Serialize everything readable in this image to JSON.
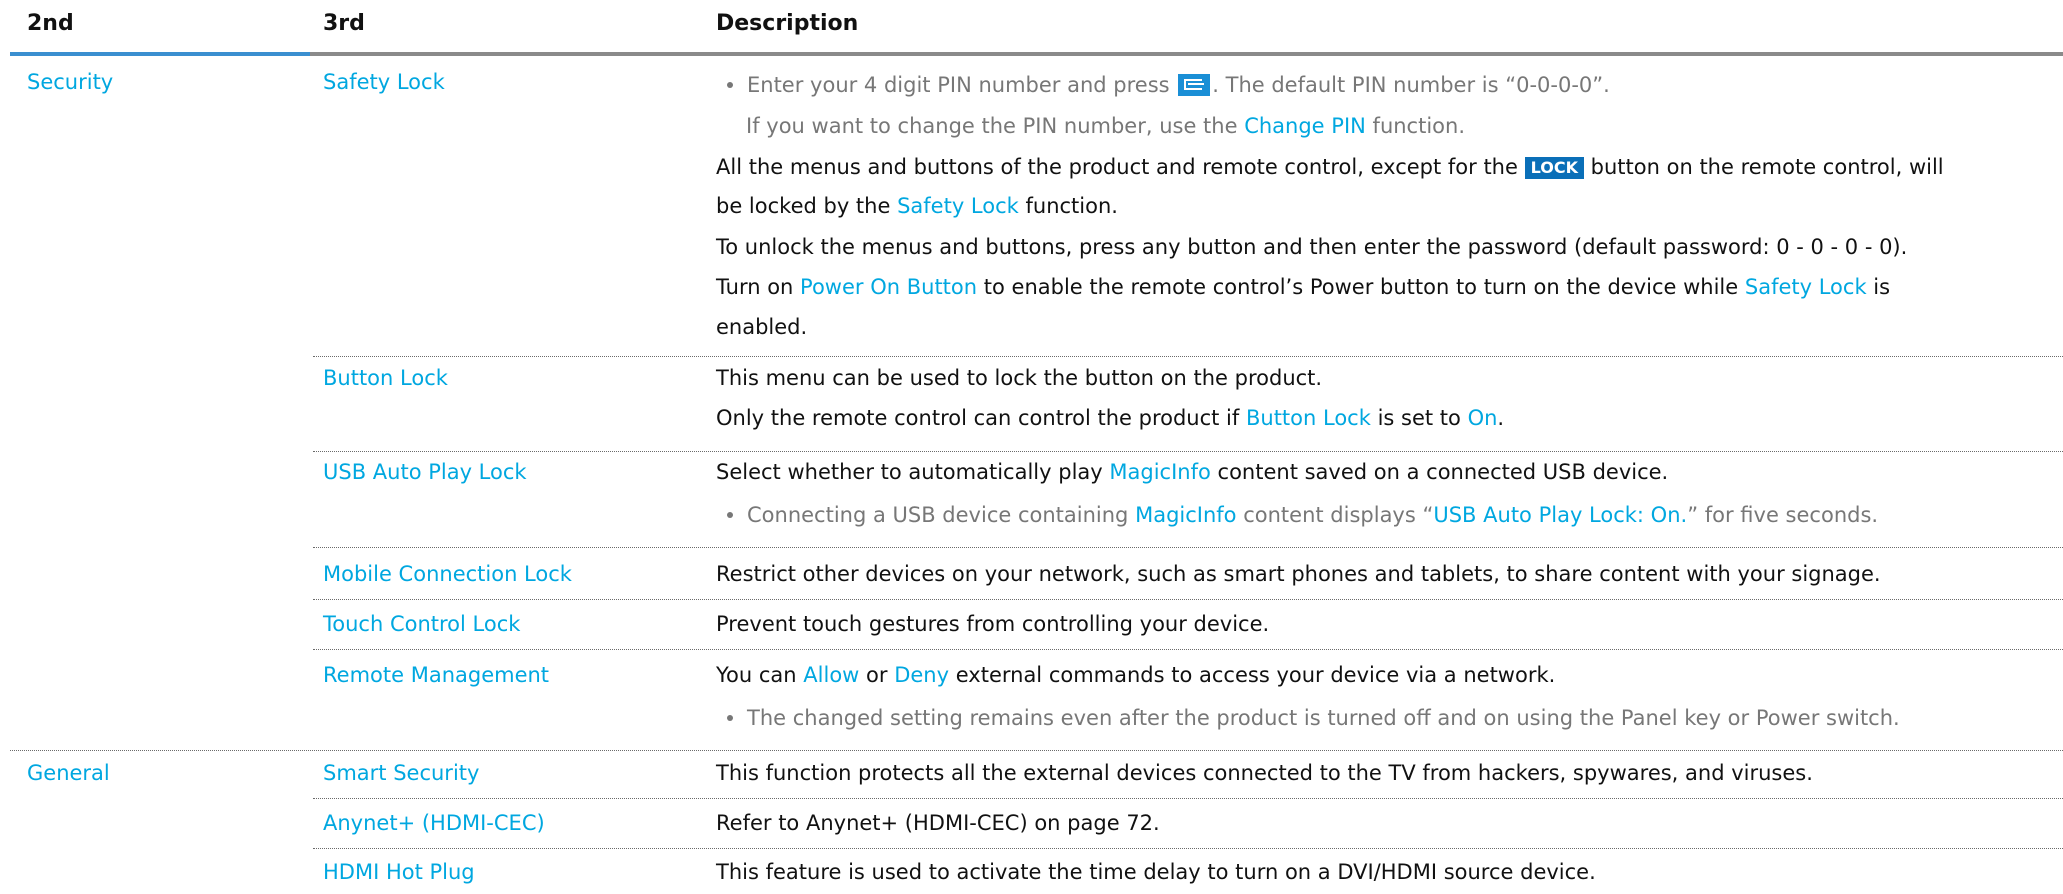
{
  "header": {
    "col2": "2nd",
    "col3": "3rd",
    "col_desc": "Description"
  },
  "security": {
    "label": "Security",
    "safety_lock": {
      "label": "Safety Lock",
      "b1_a": "Enter your 4 digit PIN number and press",
      "b1_b": ". The default PIN number is “0-0-0-0”.",
      "b1_l2_a": "If you want to change the PIN number, use the",
      "b1_l2_link": "Change PIN",
      "b1_l2_b": "function.",
      "p1_a": "All the menus and buttons of the product and remote control, except for the",
      "p1_key": "LOCK",
      "p1_b": "button on the remote control, will",
      "p1_l2_a": "be locked by the",
      "p1_l2_link": "Safety Lock",
      "p1_l2_b": "function.",
      "p2": "To unlock the menus and buttons, press any button and then enter the password (default password: 0 - 0 - 0 - 0).",
      "p3_a": "Turn on",
      "p3_link1": "Power On Button",
      "p3_b": "to enable the remote control’s Power button to turn on the device while",
      "p3_link2": "Safety Lock",
      "p3_c": "is",
      "p3_l2": "enabled."
    },
    "button_lock": {
      "label": "Button Lock",
      "p1": "This menu can be used to lock the button on the product.",
      "p2_a": "Only the remote control can control the product if",
      "p2_link1": "Button Lock",
      "p2_b": "is set to",
      "p2_link2": "On",
      "p2_c": "."
    },
    "usb_lock": {
      "label": "USB Auto Play Lock",
      "p1_a": "Select whether to automatically play",
      "p1_link": "MagicInfo",
      "p1_b": "content saved on a connected USB device.",
      "b1_a": "Connecting a USB device containing",
      "b1_link1": "MagicInfo",
      "b1_b": "content displays “",
      "b1_link2": "USB Auto Play Lock: On.",
      "b1_c": "” for five seconds."
    },
    "mobile_lock": {
      "label": "Mobile Connection Lock",
      "p1": "Restrict other devices on your network, such as smart phones and tablets, to share content with your signage."
    },
    "touch_lock": {
      "label": "Touch Control Lock",
      "p1": "Prevent touch gestures from controlling your device."
    },
    "remote_mgmt": {
      "label": "Remote Management",
      "p1_a": "You can",
      "p1_link1": "Allow",
      "p1_b": "or",
      "p1_link2": "Deny",
      "p1_c": "external commands to access your device via a network.",
      "b1": "The changed setting remains even after the product is turned off and on using the Panel key or Power switch."
    }
  },
  "general": {
    "label": "General",
    "smart_security": {
      "label": "Smart Security",
      "p1": "This function protects all the external devices connected to the TV from hackers, spywares, and viruses."
    },
    "anynet": {
      "label": "Anynet+ (HDMI-CEC)",
      "p1_a": "Refer to",
      "p1_ref": "Anynet+ (HDMI-CEC)",
      "p1_b": "on page",
      "p1_page": "72",
      "p1_c": "."
    },
    "hdmi_hot_plug": {
      "label": "HDMI Hot Plug",
      "p1": "This feature is used to activate the time delay to turn on a DVI/HDMI source device."
    }
  },
  "colors": {
    "highlight": "#00a7e0",
    "dim_text": "#777777",
    "key_bg": "#1a8fd6"
  },
  "icons": {
    "enter_key": "enter-key-icon",
    "lock_key": "lock-key-icon"
  }
}
